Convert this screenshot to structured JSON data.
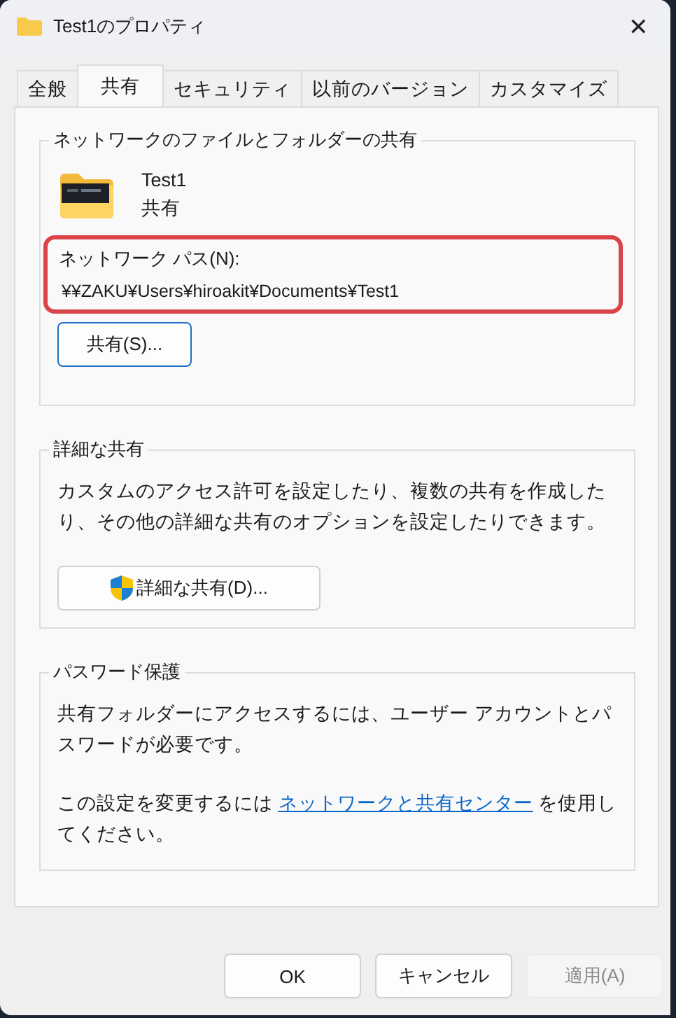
{
  "window": {
    "title": "Test1のプロパティ",
    "close": "✕"
  },
  "tabs": [
    {
      "label": "全般",
      "selected": false
    },
    {
      "label": "共有",
      "selected": true
    },
    {
      "label": "セキュリティ",
      "selected": false
    },
    {
      "label": "以前のバージョン",
      "selected": false
    },
    {
      "label": "カスタマイズ",
      "selected": false
    }
  ],
  "network_sharing": {
    "title": "ネットワークのファイルとフォルダーの共有",
    "folder_name": "Test1",
    "folder_status": "共有",
    "path_label": "ネットワーク パス(N):",
    "path": "¥¥ZAKU¥Users¥hiroakit¥Documents¥Test1",
    "path_highlighted": true,
    "button": "共有(S)..."
  },
  "advanced_sharing": {
    "title": "詳細な共有",
    "description": "カスタムのアクセス許可を設定したり、複数の共有を作成したり、その他の詳細な共有のオプションを設定したりできます。",
    "button": "詳細な共有(D)..."
  },
  "password_protection": {
    "title": "パスワード保護",
    "description": "共有フォルダーにアクセスするには、ユーザー アカウントとパスワードが必要です。",
    "change_before": "この設定を変更するには ",
    "link": "ネットワークと共有センター",
    "change_after": " を使用してください。"
  },
  "buttons": [
    {
      "label": "OK",
      "disabled": false
    },
    {
      "label": "キャンセル",
      "disabled": false
    },
    {
      "label": "適用(A)",
      "disabled": true
    }
  ]
}
